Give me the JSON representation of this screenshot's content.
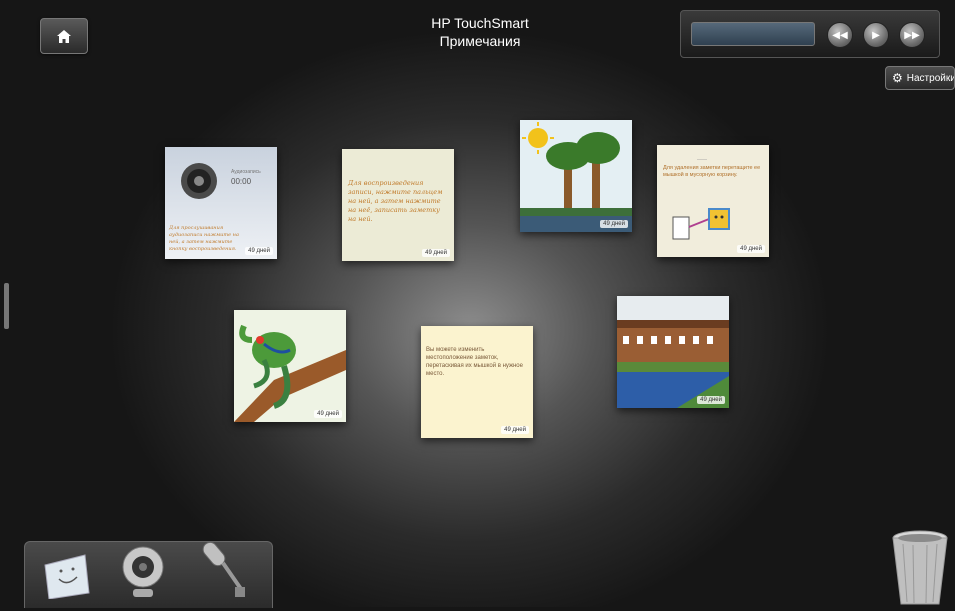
{
  "header": {
    "title_line1": "HP TouchSmart",
    "title_line2": "Примечания"
  },
  "settings": {
    "label": "Настройки",
    "icon": "gear-icon"
  },
  "media": {
    "rewind_icon": "rewind-icon",
    "play_icon": "play-icon",
    "forward_icon": "fast-forward-icon"
  },
  "notes": [
    {
      "id": "audio",
      "age": "49 дней",
      "duration": "00:00",
      "small_label": "Аудиозапись",
      "text": "Для прослушивания аудиозаписи нажмите на ней, а затем нажмите кнопку воспроизведения."
    },
    {
      "id": "handwritten",
      "age": "49 дней",
      "text": "Для воспроизведения записи, нажмите пальцем на ней, а затем нажмите на неё, записать заметку на ней."
    },
    {
      "id": "trees",
      "age": "49 дней"
    },
    {
      "id": "delete",
      "age": "49 дней",
      "small_label": "——",
      "text": "Для удаления заметки перетащите ее мышкой в мусорную корзину."
    },
    {
      "id": "frog",
      "age": "49 дней"
    },
    {
      "id": "move",
      "age": "49 дней",
      "text": "Вы можете изменить местоположение заметок, перетаскивая их мышкой в нужное место."
    },
    {
      "id": "house",
      "age": "49 дней"
    }
  ],
  "dock": {
    "items": [
      "note-icon",
      "webcam-icon",
      "microphone-icon"
    ]
  },
  "trash": {
    "icon": "trash-icon"
  }
}
